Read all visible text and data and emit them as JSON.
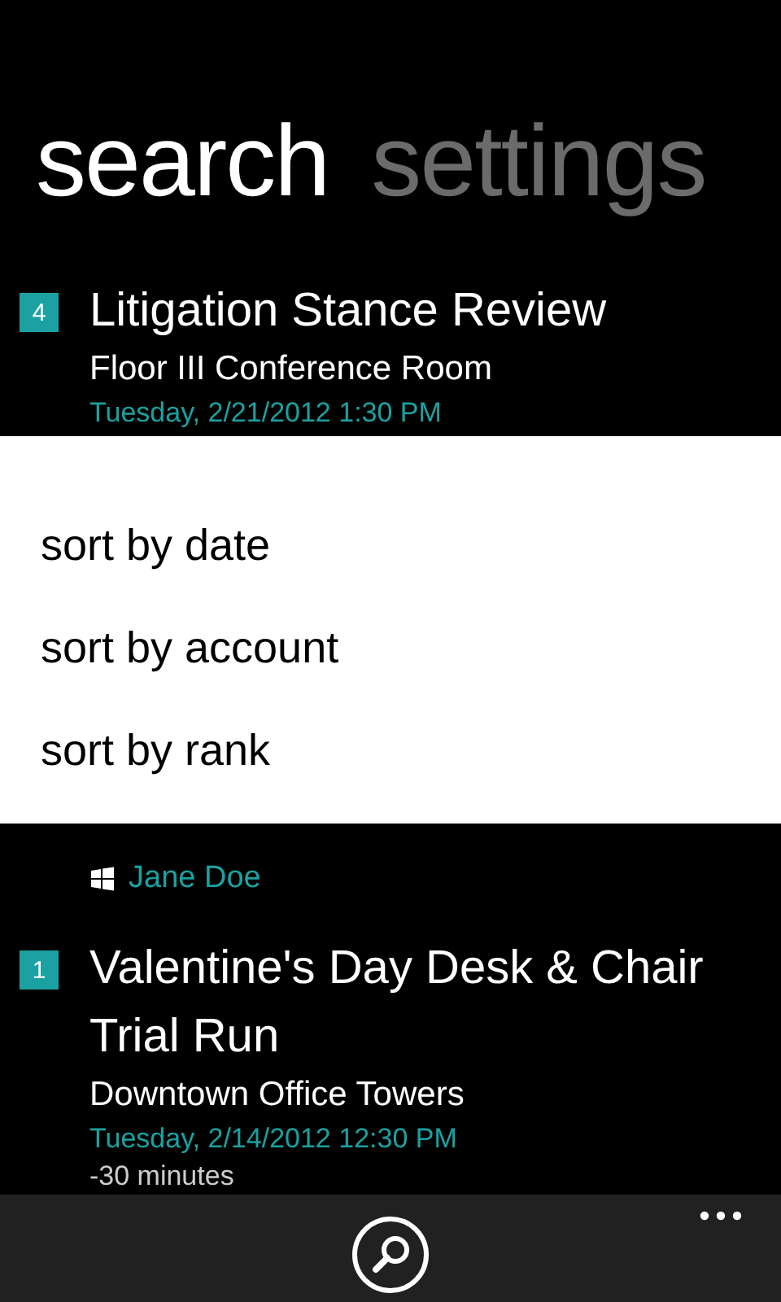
{
  "pivot": [
    {
      "label": "search",
      "selected": true
    },
    {
      "label": "settings",
      "selected": false
    }
  ],
  "results": [
    {
      "rank": "4",
      "title": "Litigation Stance Review",
      "location": "Floor III Conference Room",
      "time": "Tuesday, 2/21/2012 1:30 PM"
    },
    {
      "organizer": "Jane Doe"
    },
    {
      "rank": "1",
      "title": "Valentine's Day Desk & Chair Trial Run",
      "location": "Downtown Office Towers",
      "time": "Tuesday, 2/14/2012 12:30 PM",
      "duration": "-30 minutes"
    }
  ],
  "sort_menu": [
    "sort by date",
    "sort by account",
    "sort by rank"
  ]
}
